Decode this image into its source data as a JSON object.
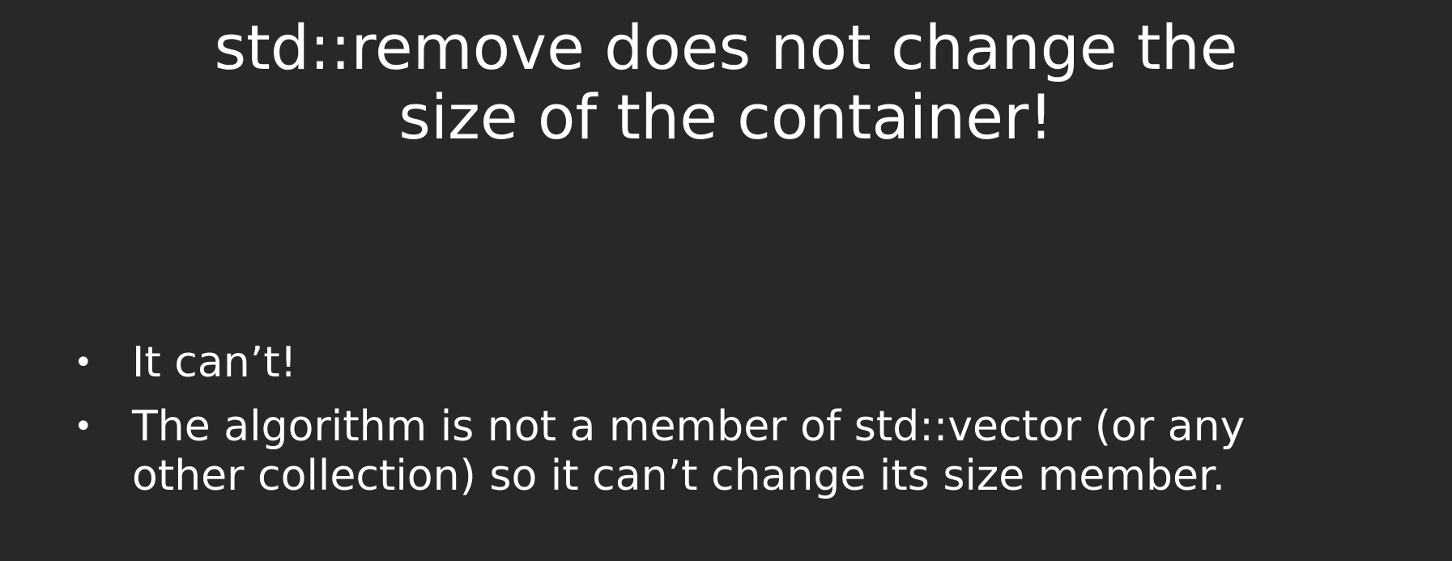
{
  "slide": {
    "title_lines": [
      "std::remove does not change the",
      "size of the container!"
    ],
    "bullets": [
      {
        "marker": "•",
        "lines": [
          "It can’t!"
        ]
      },
      {
        "marker": "•",
        "lines": [
          "The algorithm is not a member of std::vector (or any",
          "other collection) so it can’t change its size member."
        ]
      }
    ],
    "colors": {
      "background": "#282828",
      "text": "#ffffff"
    }
  }
}
